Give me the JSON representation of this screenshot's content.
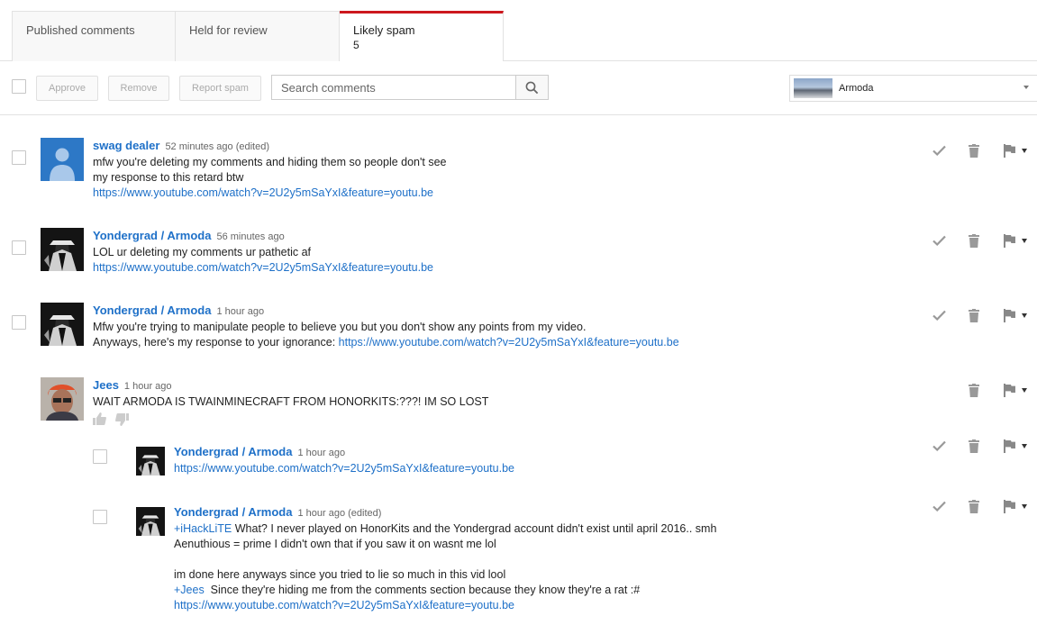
{
  "tabs": [
    {
      "label": "Published comments",
      "count": ""
    },
    {
      "label": "Held for review",
      "count": ""
    },
    {
      "label": "Likely spam",
      "count": "5"
    }
  ],
  "toolbar": {
    "approve_label": "Approve",
    "remove_label": "Remove",
    "report_label": "Report spam",
    "search_placeholder": "Search comments",
    "channel_name": "Armoda"
  },
  "colors": {
    "accent": "#cc181e",
    "link": "#1e70c8"
  },
  "comments": [
    {
      "author": "swag dealer",
      "time": "52 minutes ago (edited)",
      "lines": [
        "mfw you're deleting my comments and hiding them so people don't see",
        "my response to this retard btw"
      ],
      "link": "https://www.youtube.com/watch?v=2U2y5mSaYxI&feature=youtu.be"
    },
    {
      "author": "Yondergrad / Armoda",
      "time": "56 minutes ago",
      "lines": [
        "LOL ur deleting my comments ur pathetic af"
      ],
      "link": "https://www.youtube.com/watch?v=2U2y5mSaYxI&feature=youtu.be"
    },
    {
      "author": "Yondergrad / Armoda",
      "time": "1 hour ago",
      "lines": [
        "Mfw you're trying to manipulate people to believe you but you don't show any points from my video."
      ],
      "line_prefix": "Anyways, here's my response to your ignorance: ",
      "link": "https://www.youtube.com/watch?v=2U2y5mSaYxI&feature=youtu.be"
    },
    {
      "author": "Jees",
      "time": "1 hour ago",
      "lines": [
        "WAIT ARMODA IS TWAINMINECRAFT FROM HONORKITS:???! IM SO LOST"
      ]
    },
    {
      "author": "Yondergrad / Armoda",
      "time": "1 hour ago",
      "link": "https://www.youtube.com/watch?v=2U2y5mSaYxI&feature=youtu.be"
    },
    {
      "author": "Yondergrad / Armoda",
      "time": "1 hour ago (edited)",
      "mention1": "+iHackLiTE",
      "line1_rest": " What? I never played on HonorKits and the Yondergrad account didn't exist until april 2016.. smh",
      "line2": "Aenuthious = prime I didn't own that if you saw it on wasnt me lol",
      "line3": "im done here anyways since you tried to lie so much in this vid lool",
      "mention2": "+Jees",
      "line4_rest": "  Since they're hiding me from the comments section because they know they're a rat :#",
      "link": "https://www.youtube.com/watch?v=2U2y5mSaYxI&feature=youtu.be"
    }
  ]
}
